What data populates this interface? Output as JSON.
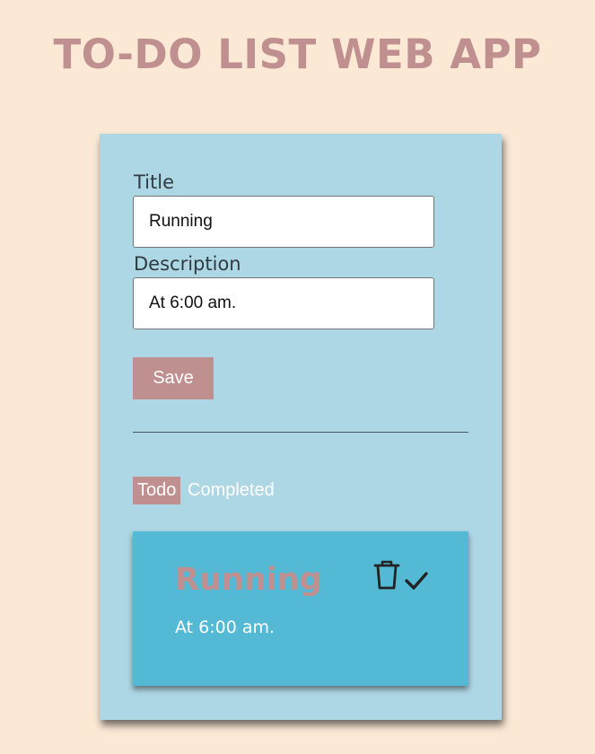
{
  "header": {
    "title": "TO-DO LIST WEB APP"
  },
  "form": {
    "title_label": "Title",
    "title_value": "Running",
    "description_label": "Description",
    "description_value": "At 6:00 am.",
    "save_label": "Save"
  },
  "tabs": {
    "todo": "Todo",
    "completed": "Completed",
    "active": "Todo"
  },
  "todos": [
    {
      "title": "Running",
      "description": "At 6:00 am.",
      "icons": [
        "trash-icon",
        "check-icon"
      ]
    }
  ],
  "colors": {
    "background": "#fbe9d6",
    "card": "#aed7e5",
    "accent": "#c09090",
    "item": "#53b9d4"
  }
}
